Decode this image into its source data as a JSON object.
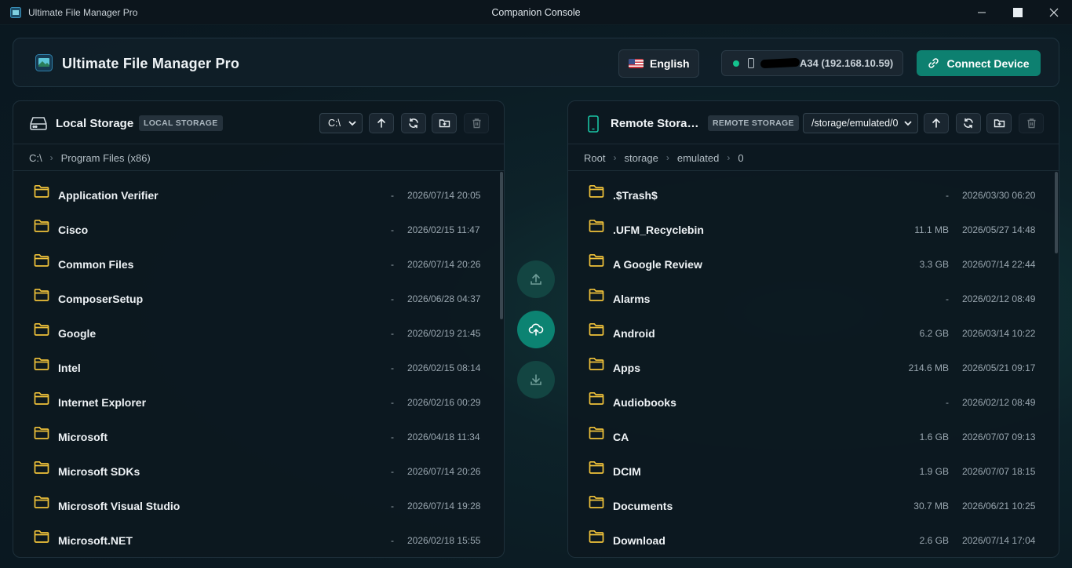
{
  "window": {
    "app_title": "Ultimate File Manager Pro",
    "center_title": "Companion Console"
  },
  "header": {
    "brand": "Ultimate File Manager Pro",
    "language": "English",
    "device": "A34 (192.168.10.59)",
    "connect_label": "Connect Device",
    "status_color": "#14c38e",
    "accent_color": "#0d8070"
  },
  "local": {
    "title": "Local Storage",
    "badge": "LOCAL STORAGE",
    "drive": "C:\\",
    "breadcrumb": [
      "C:\\",
      "Program Files (x86)"
    ],
    "rows": [
      {
        "name": "Application Verifier",
        "size": "-",
        "date": "2026/07/14 20:05"
      },
      {
        "name": "Cisco",
        "size": "-",
        "date": "2026/02/15 11:47"
      },
      {
        "name": "Common Files",
        "size": "-",
        "date": "2026/07/14 20:26"
      },
      {
        "name": "ComposerSetup",
        "size": "-",
        "date": "2026/06/28 04:37"
      },
      {
        "name": "Google",
        "size": "-",
        "date": "2026/02/19 21:45"
      },
      {
        "name": "Intel",
        "size": "-",
        "date": "2026/02/15 08:14"
      },
      {
        "name": "Internet Explorer",
        "size": "-",
        "date": "2026/02/16 00:29"
      },
      {
        "name": "Microsoft",
        "size": "-",
        "date": "2026/04/18 11:34"
      },
      {
        "name": "Microsoft SDKs",
        "size": "-",
        "date": "2026/07/14 20:26"
      },
      {
        "name": "Microsoft Visual Studio",
        "size": "-",
        "date": "2026/07/14 19:28"
      },
      {
        "name": "Microsoft.NET",
        "size": "-",
        "date": "2026/02/18 15:55"
      }
    ]
  },
  "remote": {
    "title": "Remote Storage",
    "badge": "REMOTE STORAGE",
    "path": "/storage/emulated/0",
    "breadcrumb": [
      "Root",
      "storage",
      "emulated",
      "0"
    ],
    "rows": [
      {
        "name": ".$Trash$",
        "size": "-",
        "date": "2026/03/30 06:20"
      },
      {
        "name": ".UFM_Recyclebin",
        "size": "11.1 MB",
        "date": "2026/05/27 14:48"
      },
      {
        "name": "A Google Review",
        "size": "3.3 GB",
        "date": "2026/07/14 22:44"
      },
      {
        "name": "Alarms",
        "size": "-",
        "date": "2026/02/12 08:49"
      },
      {
        "name": "Android",
        "size": "6.2 GB",
        "date": "2026/03/14 10:22"
      },
      {
        "name": "Apps",
        "size": "214.6 MB",
        "date": "2026/05/21 09:17"
      },
      {
        "name": "Audiobooks",
        "size": "-",
        "date": "2026/02/12 08:49"
      },
      {
        "name": "CA",
        "size": "1.6 GB",
        "date": "2026/07/07 09:13"
      },
      {
        "name": "DCIM",
        "size": "1.9 GB",
        "date": "2026/07/07 18:15"
      },
      {
        "name": "Documents",
        "size": "30.7 MB",
        "date": "2026/06/21 10:25"
      },
      {
        "name": "Download",
        "size": "2.6 GB",
        "date": "2026/07/14 17:04"
      }
    ]
  }
}
